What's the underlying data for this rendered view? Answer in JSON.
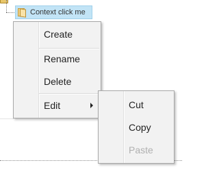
{
  "tree": {
    "node_label": "Context click me"
  },
  "context_menu": {
    "items": [
      {
        "label": "Create"
      },
      {
        "label": "Rename"
      },
      {
        "label": "Delete"
      },
      {
        "label": "Edit"
      }
    ]
  },
  "edit_submenu": {
    "items": [
      {
        "label": "Cut",
        "enabled": true
      },
      {
        "label": "Copy",
        "enabled": true
      },
      {
        "label": "Paste",
        "enabled": false
      }
    ]
  },
  "colors": {
    "node_highlight": "#c2e4f6",
    "menu_background": "#f2f2f2",
    "disabled_text": "#b0b0b0"
  },
  "icons": {
    "tree_node": "folder-icon",
    "submenu_indicator": "chevron-right-icon"
  }
}
